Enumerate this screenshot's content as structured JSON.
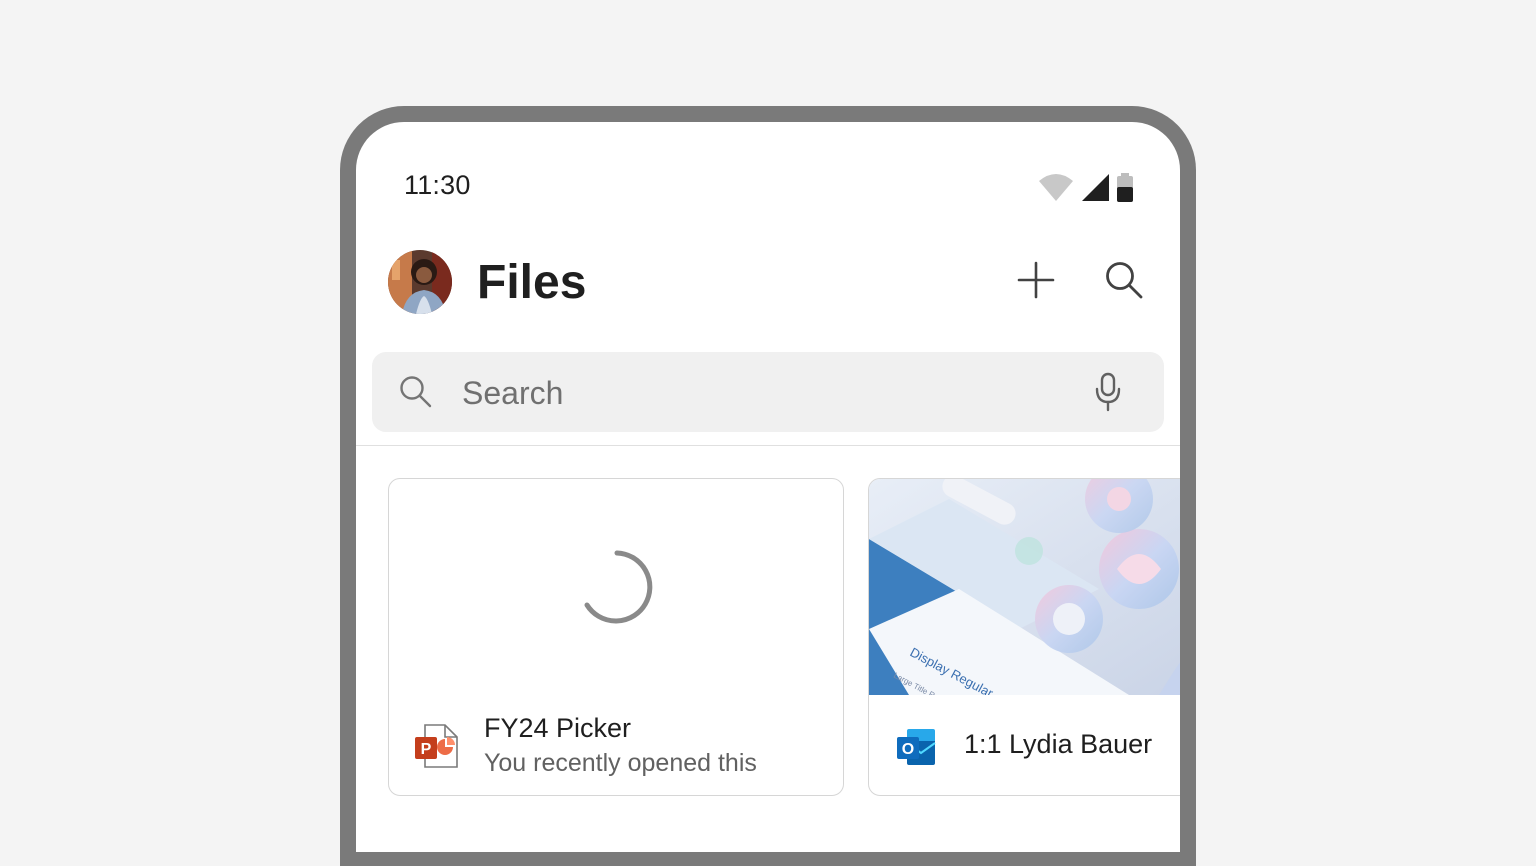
{
  "status_bar": {
    "time": "11:30",
    "icons": [
      "wifi-icon",
      "cellular-signal-icon",
      "battery-icon"
    ]
  },
  "header": {
    "title": "Files",
    "avatar": "user-avatar",
    "actions": [
      "add-icon",
      "search-icon"
    ]
  },
  "search": {
    "placeholder": "Search",
    "value": "",
    "icons": [
      "search-icon",
      "microphone-icon"
    ]
  },
  "cards": [
    {
      "title": "FY24 Picker",
      "subtitle": "You recently opened this",
      "icon": "powerpoint-icon",
      "preview": "loading-spinner"
    },
    {
      "title": "1:1 Lydia Bauer",
      "icon": "outlook-icon",
      "preview": "thumbnail-image"
    }
  ],
  "colors": {
    "background": "#f4f4f4",
    "frame": "#7a7a7a",
    "powerpoint": "#c43e1c",
    "outlook": "#0f6cbd"
  }
}
